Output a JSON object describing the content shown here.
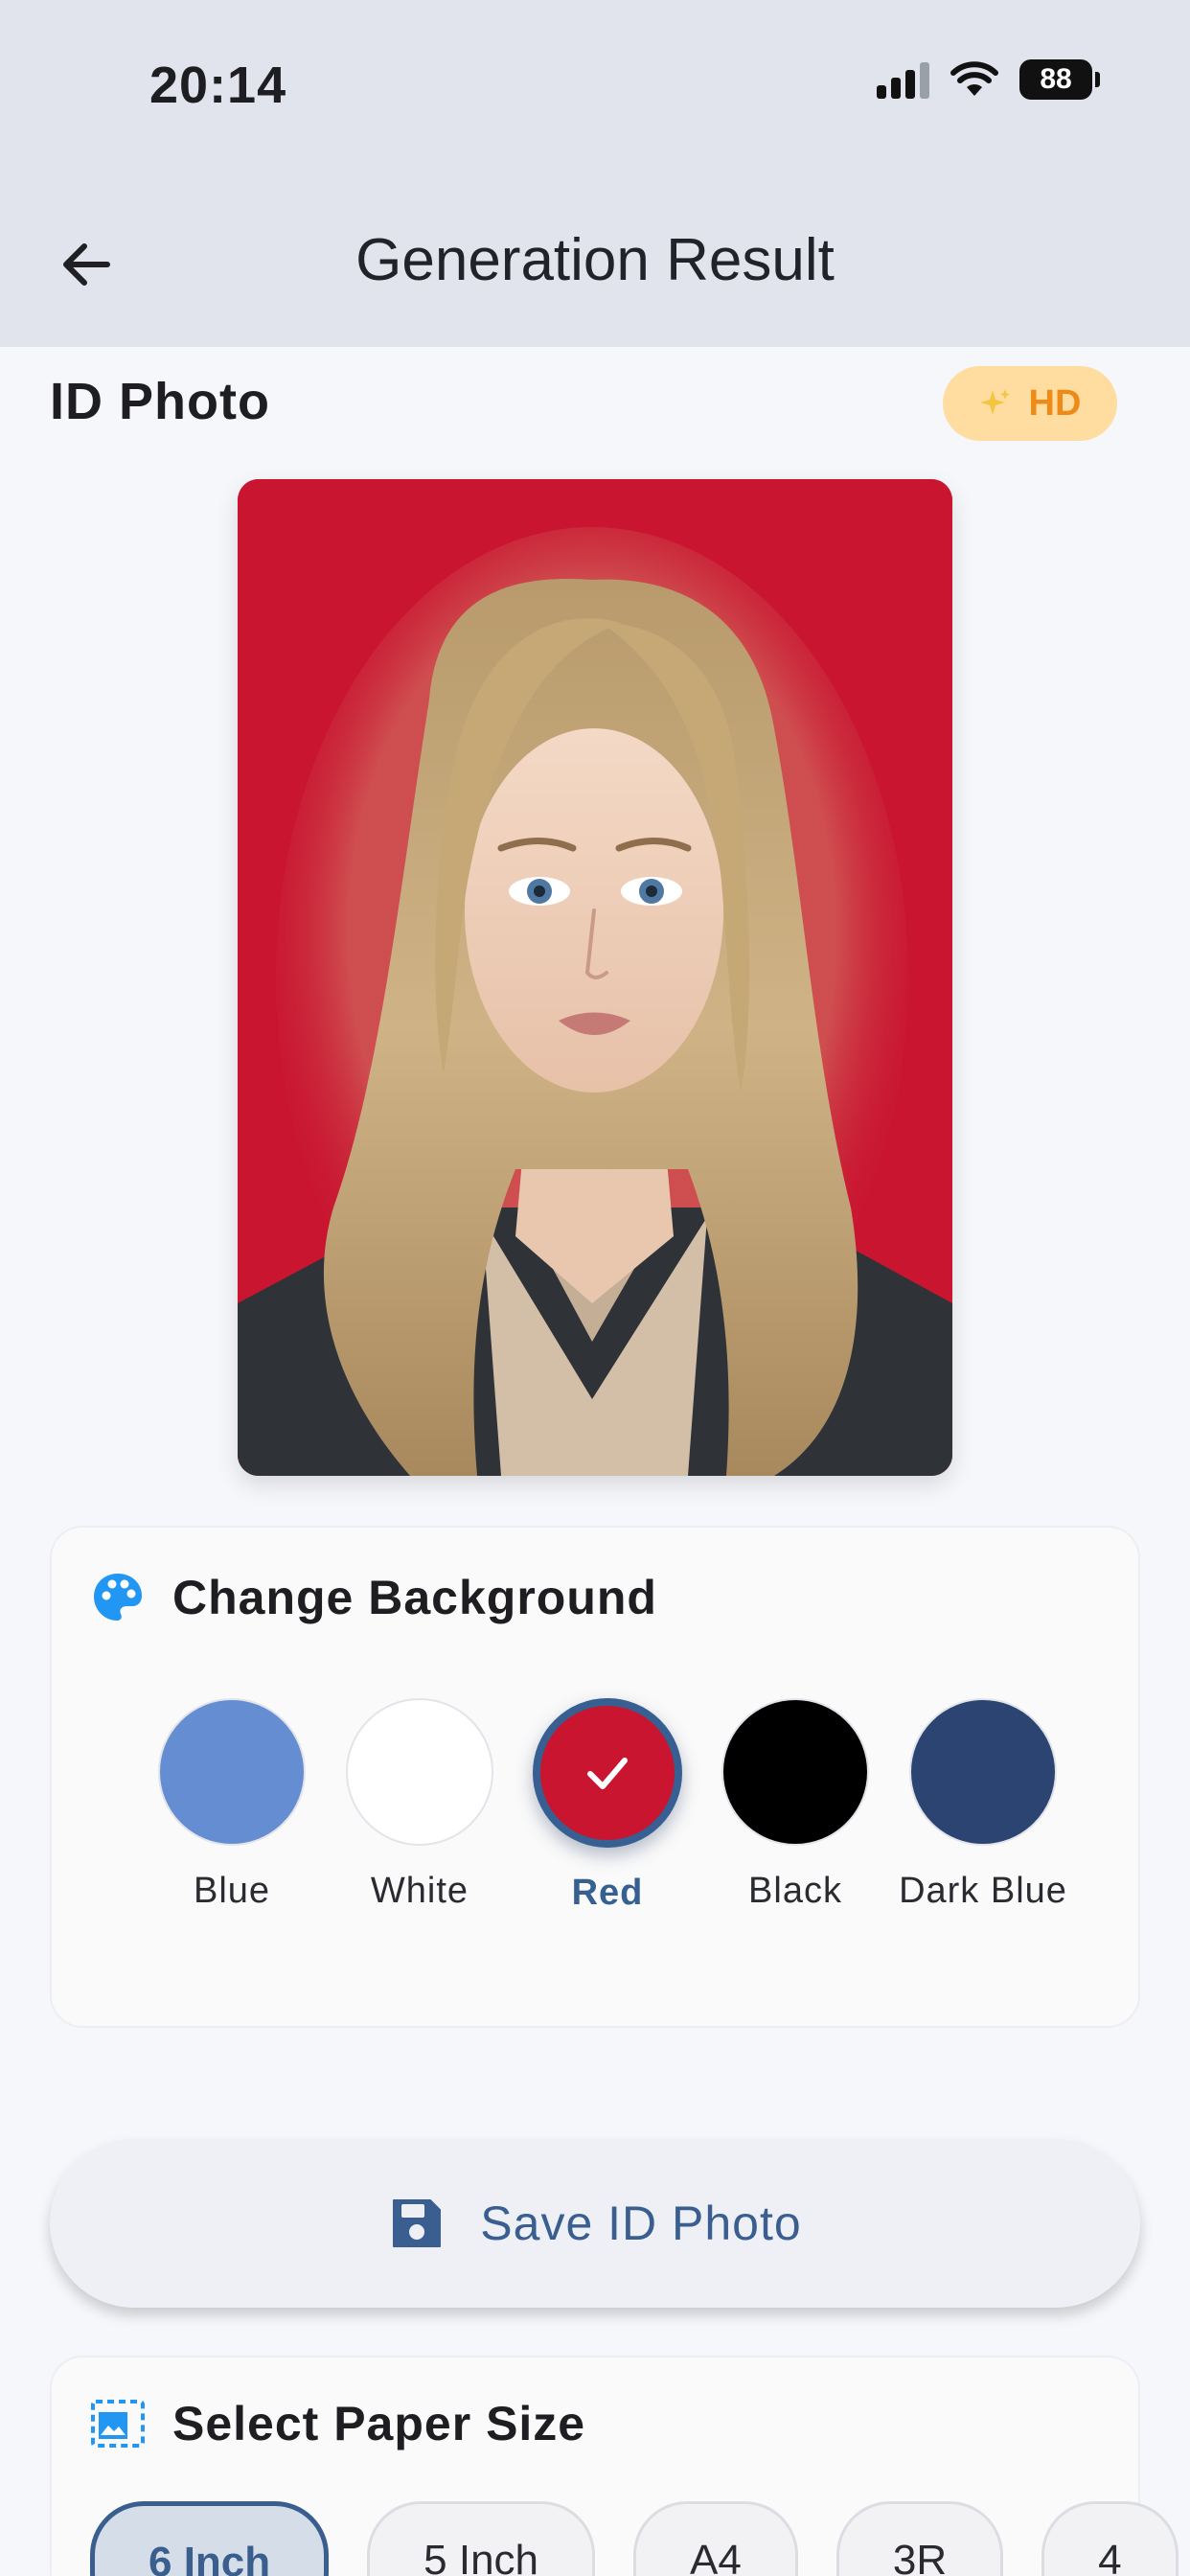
{
  "status_bar": {
    "time": "20:14",
    "battery": "88"
  },
  "header": {
    "title": "Generation Result"
  },
  "photo_section": {
    "title": "ID Photo",
    "badge_icon": "sparkles-icon",
    "badge_label": "HD"
  },
  "background_card": {
    "title": "Change Background",
    "icon": "palette-icon",
    "options": [
      {
        "label": "Blue",
        "color": "#658ed2",
        "selected": false
      },
      {
        "label": "White",
        "color": "#ffffff",
        "selected": false
      },
      {
        "label": "Red",
        "color": "#c91530",
        "selected": true
      },
      {
        "label": "Black",
        "color": "#000000",
        "selected": false
      },
      {
        "label": "Dark Blue",
        "color": "#2c4472",
        "selected": false
      }
    ]
  },
  "save_button": {
    "label": "Save ID Photo",
    "icon": "save-icon"
  },
  "paper_card": {
    "title": "Select Paper Size",
    "icon": "image-size-icon",
    "sizes": [
      {
        "label": "6 Inch",
        "selected": true
      },
      {
        "label": "5 Inch",
        "selected": false
      },
      {
        "label": "A4",
        "selected": false
      },
      {
        "label": "3R",
        "selected": false
      },
      {
        "label": "4",
        "selected": false
      }
    ]
  },
  "colors": {
    "accent": "#375f91",
    "photo_background": "#c91530",
    "hd_badge": "#ffdca0"
  }
}
